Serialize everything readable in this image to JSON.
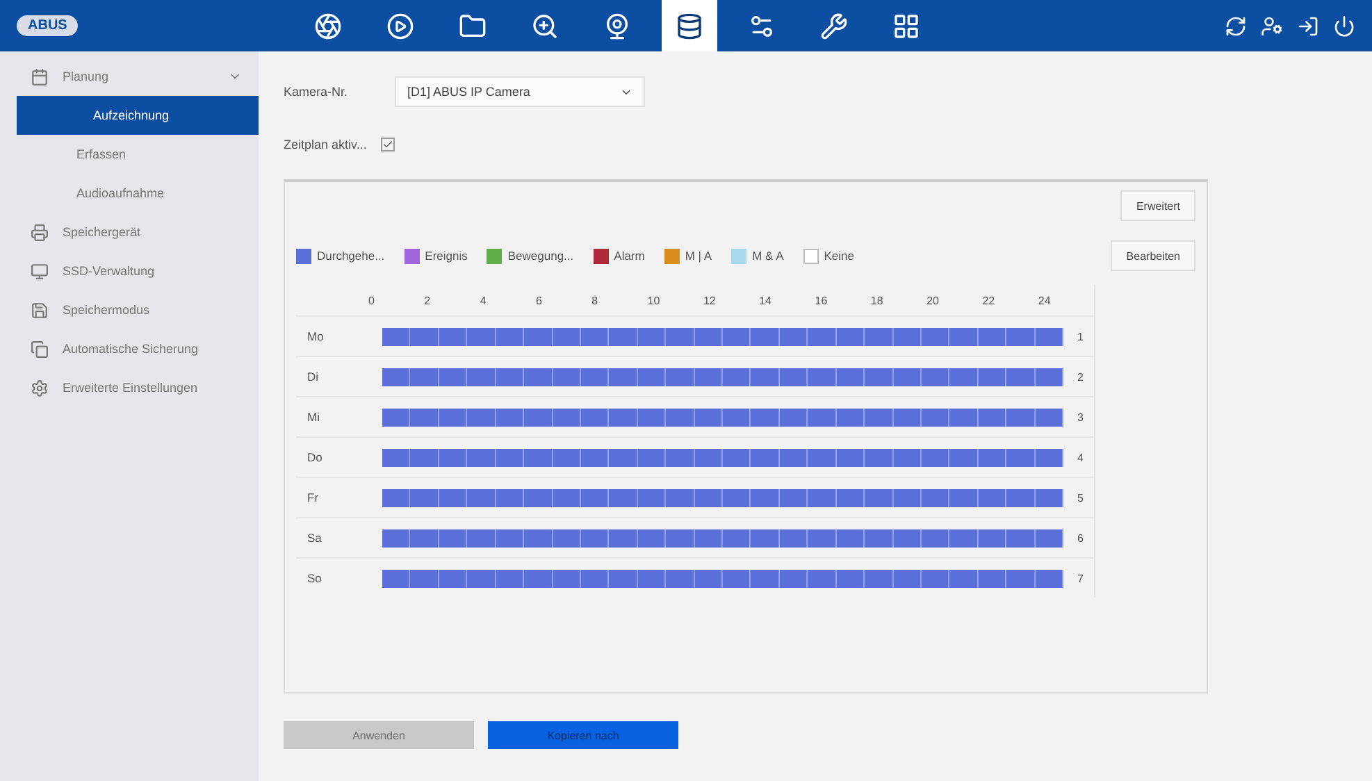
{
  "top_bar": {
    "logo": "ABUS",
    "tabs": [
      {
        "kind": "live",
        "selected": false
      },
      {
        "kind": "playback",
        "selected": false
      },
      {
        "kind": "files",
        "selected": false
      },
      {
        "kind": "search",
        "selected": false
      },
      {
        "kind": "camera",
        "selected": false
      },
      {
        "kind": "storage",
        "selected": true
      },
      {
        "kind": "system",
        "selected": false
      },
      {
        "kind": "maintenance",
        "selected": false
      },
      {
        "kind": "layout",
        "selected": false
      }
    ]
  },
  "sidebar": {
    "items": [
      {
        "label": "Planung",
        "kind": "calendar",
        "expanded": true,
        "children": [
          {
            "label": "Aufzeichnung",
            "selected": true
          },
          {
            "label": "Erfassen",
            "selected": false
          },
          {
            "label": "Audioaufnahme",
            "selected": false
          }
        ]
      },
      {
        "label": "Speichergerät",
        "kind": "device",
        "selected": false
      },
      {
        "label": "SSD-Verwaltung",
        "kind": "ssd",
        "selected": false
      },
      {
        "label": "Speichermodus",
        "kind": "disk",
        "selected": false
      },
      {
        "label": "Automatische Sicherung",
        "kind": "backup",
        "selected": false
      },
      {
        "label": "Erweiterte Einstellungen",
        "kind": "gear",
        "selected": false
      }
    ]
  },
  "camera": {
    "label": "Kamera-Nr.",
    "value": "[D1] ABUS IP Camera"
  },
  "schedule_enabled": {
    "label": "Zeitplan aktiv...",
    "checked": true
  },
  "buttons": {
    "advanced": "Erweitert",
    "edit": "Bearbeiten",
    "apply": "Anwenden",
    "copy": "Kopieren nach"
  },
  "legend": [
    {
      "kind": "continuous",
      "label": "Durchgehe...",
      "color": "#5b6fd8"
    },
    {
      "kind": "event",
      "label": "Ereignis",
      "color": "#a066e0"
    },
    {
      "kind": "motion",
      "label": "Bewegung...",
      "color": "#5fae4a"
    },
    {
      "kind": "alarm",
      "label": "Alarm",
      "color": "#b02a3a"
    },
    {
      "kind": "motion_or_alarm",
      "label": "M | A",
      "color": "#d88c1c"
    },
    {
      "kind": "motion_and_alarm",
      "label": "M & A",
      "color": "#a8d8ec"
    },
    {
      "kind": "none",
      "label": "Keine",
      "color": "#ffffff"
    }
  ],
  "hours": [
    "0",
    "2",
    "4",
    "6",
    "8",
    "10",
    "12",
    "14",
    "16",
    "18",
    "20",
    "22",
    "24"
  ],
  "days": [
    {
      "label": "Mo",
      "number": "1",
      "kind": "continuous"
    },
    {
      "label": "Di",
      "number": "2",
      "kind": "continuous"
    },
    {
      "label": "Mi",
      "number": "3",
      "kind": "continuous"
    },
    {
      "label": "Do",
      "number": "4",
      "kind": "continuous"
    },
    {
      "label": "Fr",
      "number": "5",
      "kind": "continuous"
    },
    {
      "label": "Sa",
      "number": "6",
      "kind": "continuous"
    },
    {
      "label": "So",
      "number": "7",
      "kind": "continuous"
    }
  ]
}
